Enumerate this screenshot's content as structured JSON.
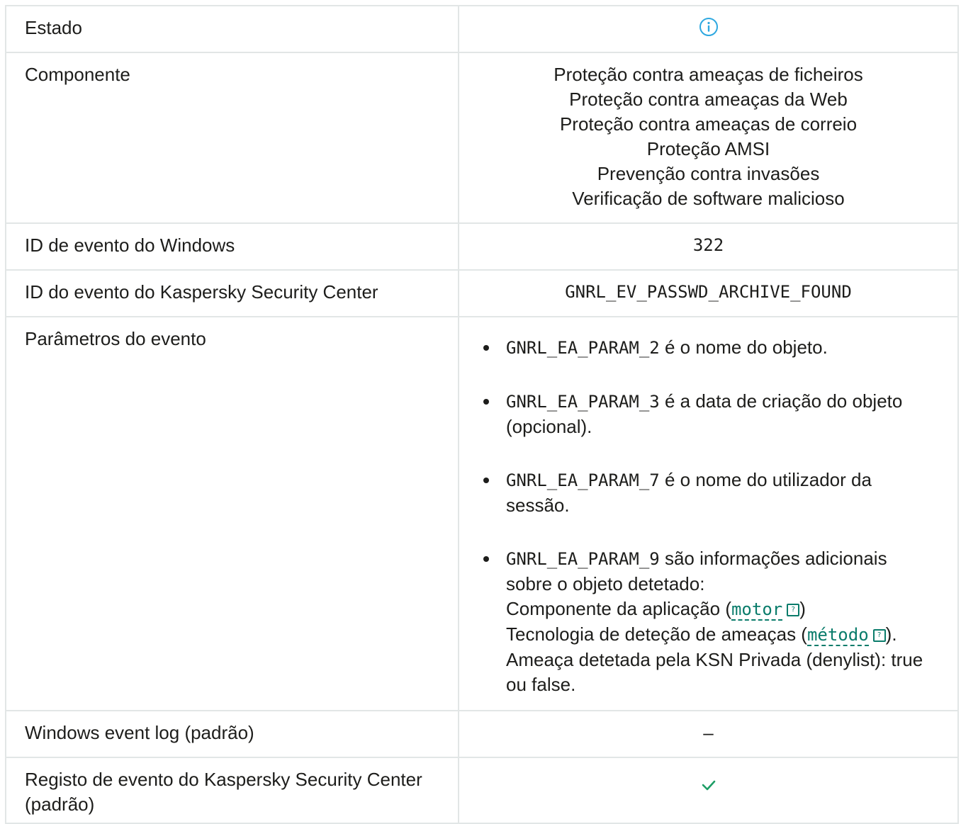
{
  "rows": {
    "estado": {
      "label": "Estado",
      "icon": "info-circle-icon"
    },
    "componente": {
      "label": "Componente",
      "values": [
        "Proteção contra ameaças de ficheiros",
        "Proteção contra ameaças da Web",
        "Proteção contra ameaças de correio",
        "Proteção AMSI",
        "Prevenção contra invasões",
        "Verificação de software malicioso"
      ]
    },
    "windows_id": {
      "label": "ID de evento do Windows",
      "value": "322"
    },
    "ksc_id": {
      "label": "ID do evento do Kaspersky Security Center",
      "value": "GNRL_EV_PASSWD_ARCHIVE_FOUND"
    },
    "params": {
      "label": "Parâmetros do evento",
      "items": [
        {
          "code": "GNRL_EA_PARAM_2",
          "text": " é o nome do objeto."
        },
        {
          "code": "GNRL_EA_PARAM_3",
          "text": " é a data de criação do objeto (opcional)."
        },
        {
          "code": "GNRL_EA_PARAM_7",
          "text": " é o nome do utilizador da sessão."
        },
        {
          "code": "GNRL_EA_PARAM_9",
          "text": " são informações adicionais sobre o objeto detetado:",
          "line1_pre": "Componente da aplicação (",
          "line1_term": "motor",
          "line1_post": ")",
          "line2_pre": "Tecnologia de deteção de ameaças (",
          "line2_term": "método",
          "line2_post": ").",
          "line3": "Ameaça detetada pela KSN Privada (denylist): true ou false."
        }
      ]
    },
    "win_log": {
      "label": "Windows event log (padrão)",
      "value": "–"
    },
    "ksc_log": {
      "label": "Registo de evento do Kaspersky Security Center (padrão)",
      "icon": "checkmark-icon"
    }
  },
  "colors": {
    "accent": "#0a7c6b",
    "info_icon": "#2ea8e0",
    "check": "#1e9e66",
    "border": "#e2e6e6"
  }
}
